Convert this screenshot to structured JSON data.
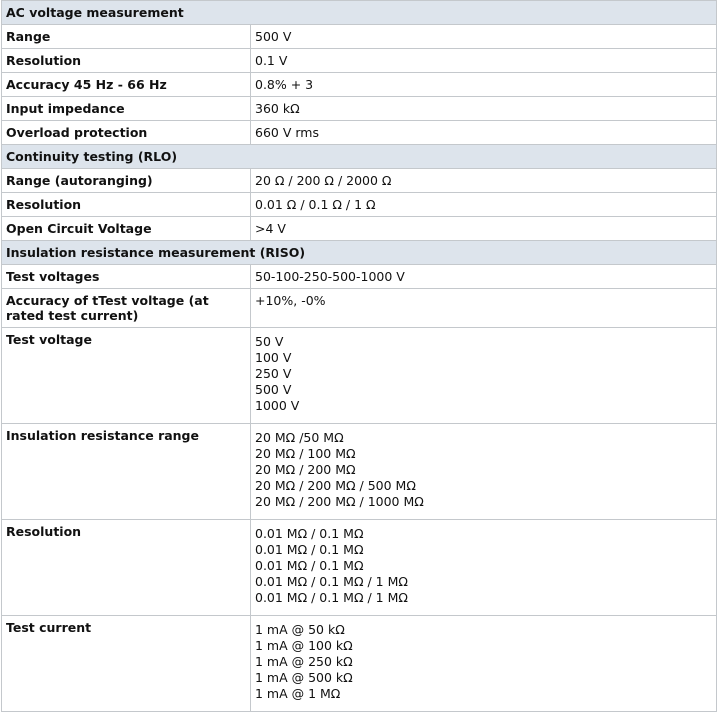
{
  "sections": [
    {
      "title": "AC voltage measurement",
      "rows": [
        {
          "label": "Range",
          "values": [
            "500 V"
          ]
        },
        {
          "label": "Resolution",
          "values": [
            "0.1 V"
          ]
        },
        {
          "label": "Accuracy 45 Hz - 66 Hz",
          "values": [
            "0.8% + 3"
          ]
        },
        {
          "label": "Input impedance",
          "values": [
            "360 kΩ"
          ]
        },
        {
          "label": "Overload protection",
          "values": [
            "660 V rms"
          ]
        }
      ]
    },
    {
      "title": "Continuity testing (RLO)",
      "rows": [
        {
          "label": "Range (autoranging)",
          "values": [
            "20 Ω / 200 Ω / 2000 Ω"
          ]
        },
        {
          "label": "Resolution",
          "values": [
            "0.01 Ω / 0.1 Ω / 1 Ω"
          ]
        },
        {
          "label": "Open Circuit Voltage",
          "values": [
            ">4 V"
          ]
        }
      ]
    },
    {
      "title": "Insulation resistance measurement (RISO)",
      "rows": [
        {
          "label": "Test voltages",
          "values": [
            "50-100-250-500-1000 V"
          ]
        },
        {
          "label": "Accuracy of tTest voltage (at rated test current)",
          "values": [
            "+10%, -0%"
          ]
        },
        {
          "label": "Test voltage",
          "values": [
            "50 V",
            "100 V",
            "250 V",
            "500 V",
            "1000 V"
          ]
        },
        {
          "label": "Insulation resistance range",
          "values": [
            "20 MΩ /50 MΩ",
            "20 MΩ / 100 MΩ",
            "20 MΩ / 200 MΩ",
            "20 MΩ / 200 MΩ / 500 MΩ",
            "20 MΩ / 200 MΩ / 1000 MΩ"
          ]
        },
        {
          "label": "Resolution",
          "values": [
            "0.01 MΩ / 0.1 MΩ",
            "0.01 MΩ / 0.1 MΩ",
            "0.01 MΩ / 0.1 MΩ",
            "0.01 MΩ / 0.1 MΩ / 1 MΩ",
            "0.01 MΩ / 0.1 MΩ / 1 MΩ"
          ]
        },
        {
          "label": "Test current",
          "values": [
            "1 mA @ 50 kΩ",
            "1 mA @ 100 kΩ",
            "1 mA @ 250 kΩ",
            "1 mA @ 500 kΩ",
            "1 mA @ 1 MΩ"
          ]
        }
      ]
    }
  ]
}
